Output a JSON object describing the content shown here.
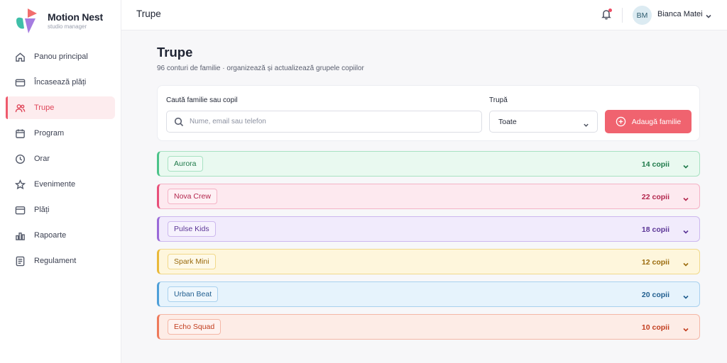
{
  "brand": {
    "name": "Motion Nest",
    "subtitle": "studio manager"
  },
  "sidebar": {
    "items": [
      {
        "label": "Panou principal",
        "icon": "home-icon",
        "active": false
      },
      {
        "label": "Încasează plăți",
        "icon": "card-icon",
        "active": false
      },
      {
        "label": "Trupe",
        "icon": "users-icon",
        "active": true
      },
      {
        "label": "Program",
        "icon": "calendar-icon",
        "active": false
      },
      {
        "label": "Orar",
        "icon": "clock-icon",
        "active": false
      },
      {
        "label": "Evenimente",
        "icon": "star-icon",
        "active": false
      },
      {
        "label": "Plăți",
        "icon": "wallet-icon",
        "active": false
      },
      {
        "label": "Rapoarte",
        "icon": "bar-chart-icon",
        "active": false
      },
      {
        "label": "Regulament",
        "icon": "document-icon",
        "active": false
      }
    ]
  },
  "header": {
    "title": "Trupe",
    "user": {
      "initials": "BM",
      "name": "Bianca Matei"
    },
    "notification_icon": "bell-icon"
  },
  "main": {
    "title": "Trupe",
    "subtitle": "96 conturi de familie · organizează și actualizează grupele copiilor"
  },
  "filters": {
    "search_label": "Caută familie sau copil",
    "search_placeholder": "Nume, email sau telefon",
    "group_label": "Trupă",
    "group_value": "Toate",
    "add_button": "Adaugă familie"
  },
  "groups": [
    {
      "name": "Aurora",
      "count": "14 copii",
      "accent": "#4cc38a",
      "bg": "#e9f9f0",
      "border": "#a8e2c2",
      "text": "#1f7a4a"
    },
    {
      "name": "Nova Crew",
      "count": "22 copii",
      "accent": "#e8507a",
      "bg": "#fde9ef",
      "border": "#f4b3c6",
      "text": "#b3264d"
    },
    {
      "name": "Pulse Kids",
      "count": "18 copii",
      "accent": "#9a6ad8",
      "bg": "#f1ebfc",
      "border": "#ccb8ee",
      "text": "#5b3596"
    },
    {
      "name": "Spark Mini",
      "count": "12 copii",
      "accent": "#e9b93a",
      "bg": "#fef6dc",
      "border": "#f1d98a",
      "text": "#9a6a0c"
    },
    {
      "name": "Urban Beat",
      "count": "20 copii",
      "accent": "#4f9fd8",
      "bg": "#e6f3fc",
      "border": "#a9d1ee",
      "text": "#1f5d8e"
    },
    {
      "name": "Echo Squad",
      "count": "10 copii",
      "accent": "#ee7a5c",
      "bg": "#fdece6",
      "border": "#f4b7a6",
      "text": "#c23d1e"
    }
  ]
}
